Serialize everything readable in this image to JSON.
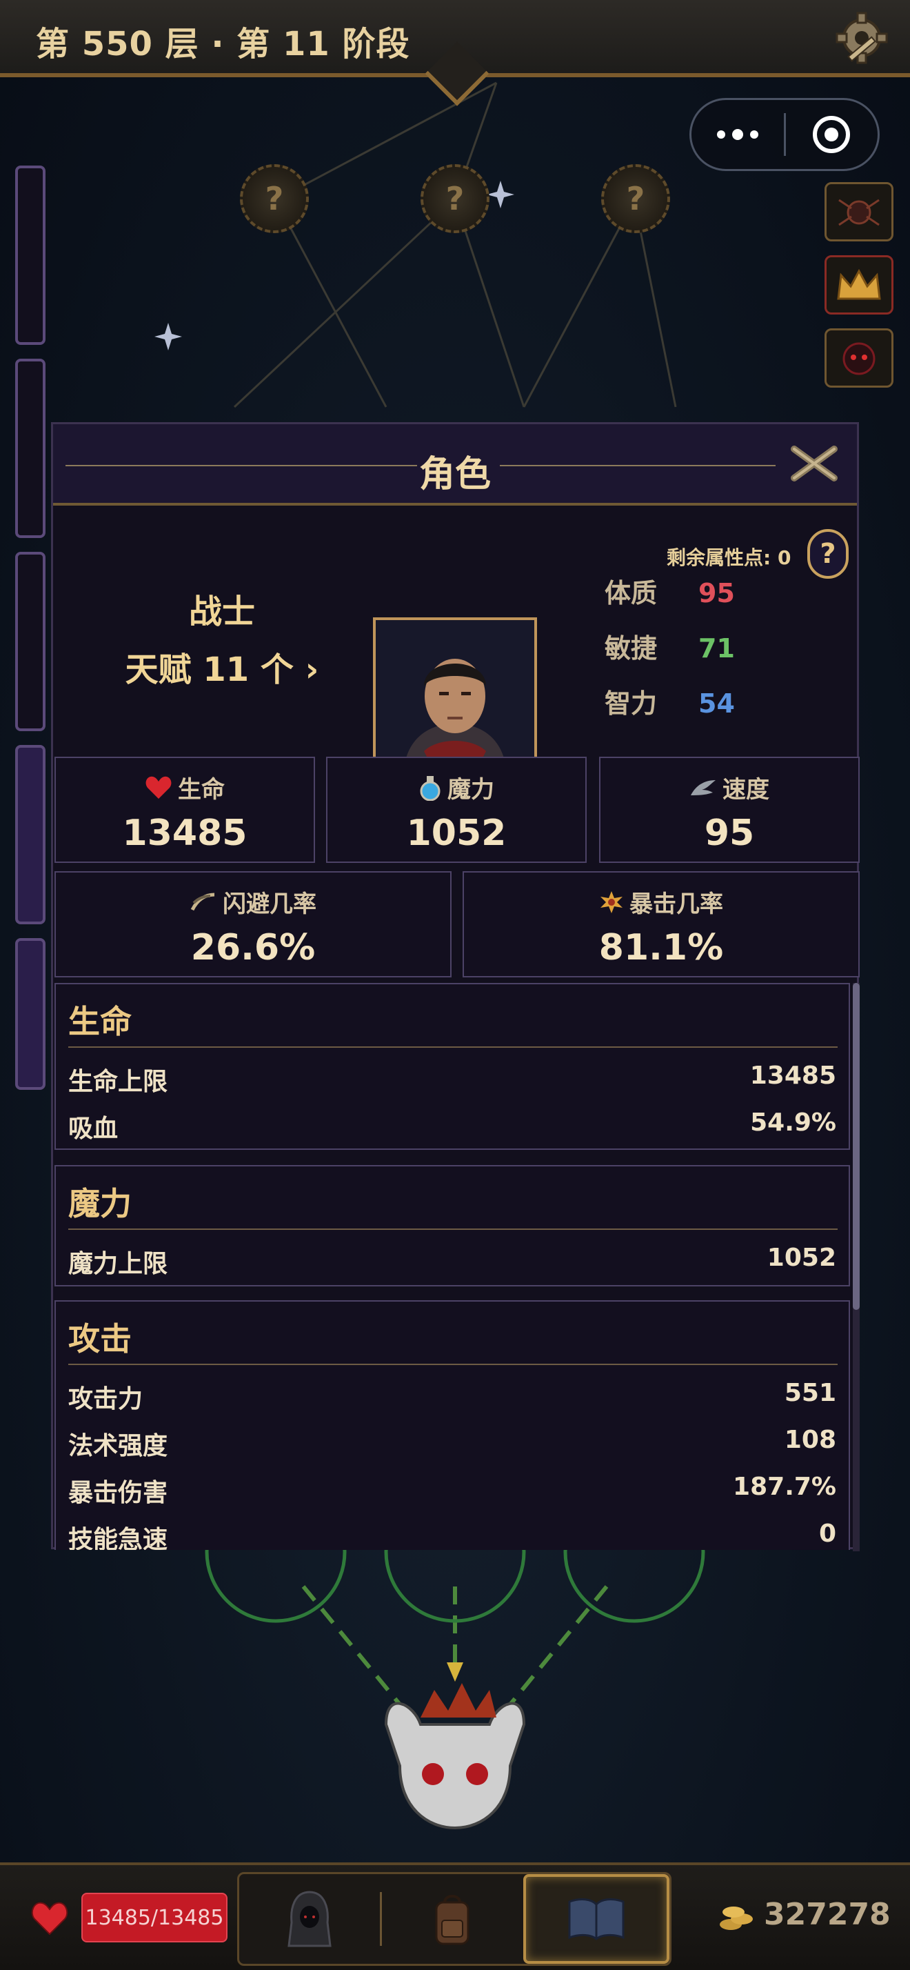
{
  "header": {
    "title": "第 550 层 · 第 11 阶段"
  },
  "map": {
    "unknown_node_symbol": "?"
  },
  "panel": {
    "title": "角色",
    "remaining_points_label": "剩余属性点: 0",
    "help_symbol": "?",
    "class_name": "战士",
    "talent_label": "天赋 11 个 ›",
    "attributes": [
      {
        "label": "体质",
        "value": "95",
        "color": "#e0505a"
      },
      {
        "label": "敏捷",
        "value": "71",
        "color": "#6cc266"
      },
      {
        "label": "智力",
        "value": "54",
        "color": "#5a93e0"
      }
    ],
    "stats_row1": [
      {
        "label": "生命",
        "value": "13485",
        "icon": "heart-icon"
      },
      {
        "label": "魔力",
        "value": "1052",
        "icon": "potion-icon"
      },
      {
        "label": "速度",
        "value": "95",
        "icon": "wing-icon"
      }
    ],
    "stats_row2": [
      {
        "label": "闪避几率",
        "value": "26.6%",
        "icon": "dodge-icon"
      },
      {
        "label": "暴击几率",
        "value": "81.1%",
        "icon": "crit-icon"
      }
    ],
    "sections": {
      "life": {
        "title": "生命",
        "rows": [
          {
            "label": "生命上限",
            "value": "13485"
          },
          {
            "label": "吸血",
            "value": "54.9%"
          }
        ]
      },
      "mana": {
        "title": "魔力",
        "rows": [
          {
            "label": "魔力上限",
            "value": "1052"
          }
        ]
      },
      "attack": {
        "title": "攻击",
        "rows": [
          {
            "label": "攻击力",
            "value": "551"
          },
          {
            "label": "法术强度",
            "value": "108"
          },
          {
            "label": "暴击伤害",
            "value": "187.7%"
          },
          {
            "label": "技能急速",
            "value": "0"
          }
        ]
      }
    }
  },
  "bottom": {
    "hp_text": "13485/13485",
    "coins": "327278",
    "tabs": [
      "character-tab",
      "backpack-tab",
      "book-tab"
    ]
  }
}
